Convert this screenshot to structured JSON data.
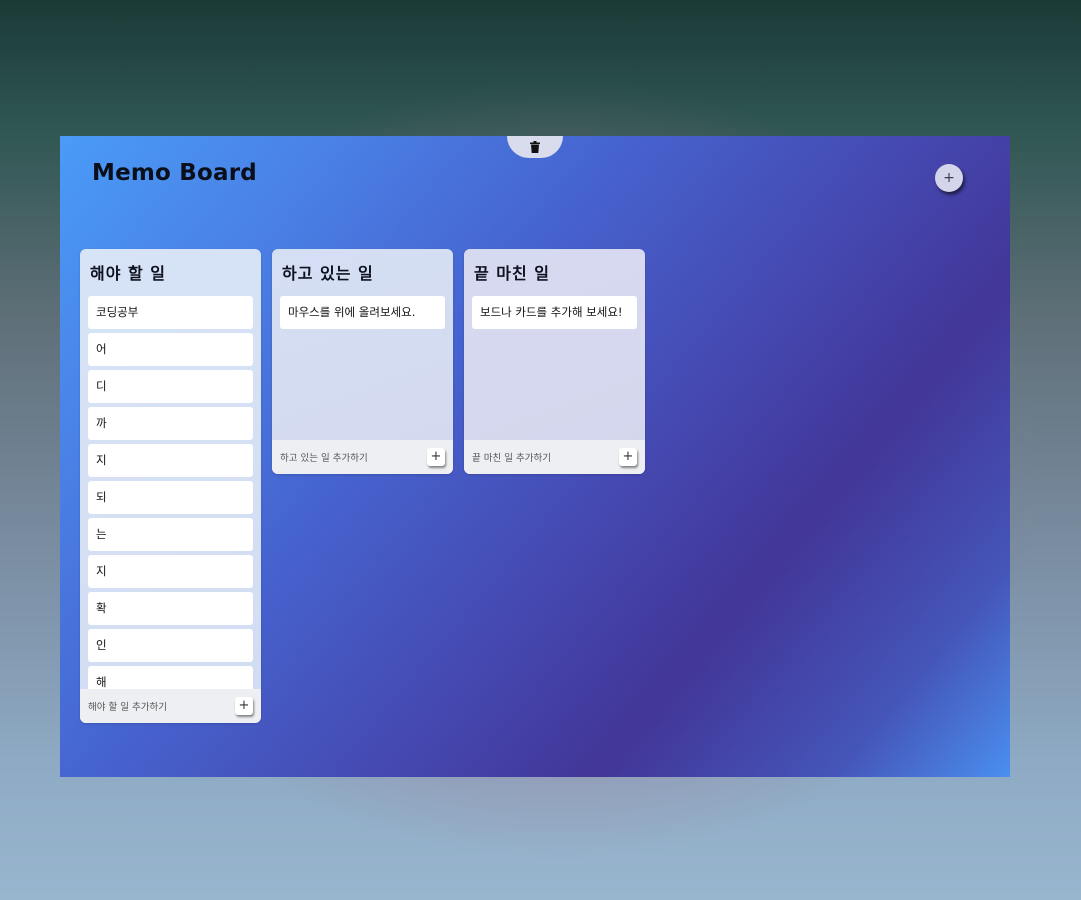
{
  "board": {
    "title": "Memo Board",
    "add_board_label": "+",
    "trash_icon": "trash-icon"
  },
  "columns": [
    {
      "title": "해야 할 일",
      "cards": [
        "코딩공부",
        "어",
        "디",
        "까",
        "지",
        "되",
        "는",
        "지",
        "확",
        "인",
        "해"
      ],
      "footer_label": "해야 할 일 추가하기",
      "add_label": "+"
    },
    {
      "title": "하고 있는 일",
      "cards": [
        "마우스를 위에 올려보세요."
      ],
      "footer_label": "하고 있는 일 추가하기",
      "add_label": "+"
    },
    {
      "title": "끝 마친 일",
      "cards": [
        "보드나 카드를 추가해 보세요!"
      ],
      "footer_label": "끝 마친 일 추가하기",
      "add_label": "+"
    }
  ]
}
